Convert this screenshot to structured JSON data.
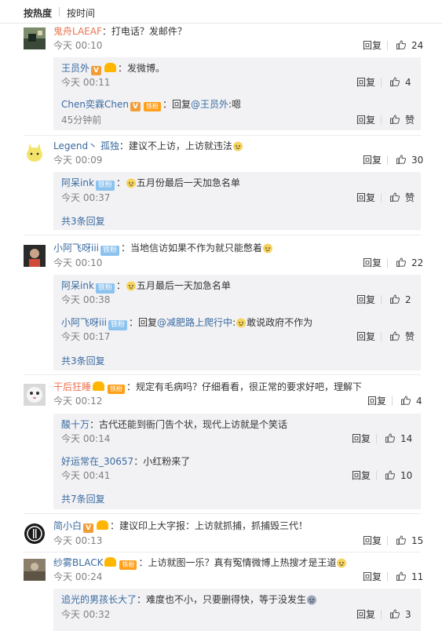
{
  "sort_tabs": {
    "hot": "按热度",
    "time": "按时间"
  },
  "labels": {
    "reply": "回复",
    "like": "赞"
  },
  "comments": [
    {
      "user": "鬼舟LAEAF",
      "text": "：打电话？发邮件？",
      "time": "今天 00:10",
      "likes": "24",
      "replies": [
        {
          "user": "王员外",
          "text": "：发微博。",
          "time": "今天 00:11",
          "likes": "4"
        },
        {
          "user": "Chen奕霖Chen",
          "badge_text": "铁粉",
          "text": "：回复",
          "mention": "@王员外",
          "text2": ":嗯",
          "time": "45分钟前",
          "likes": "赞"
        }
      ]
    },
    {
      "user": "Legend丶 孤独",
      "text": "：建议不上访，上访就违法",
      "time": "今天 00:09",
      "likes": "30",
      "replies": [
        {
          "user": "阿呆ink",
          "badge_text": "铁粉",
          "text": "：",
          "text2": "五月份最后一天加急名单",
          "time": "今天 00:37",
          "likes": "赞"
        }
      ],
      "more": "共3条回复"
    },
    {
      "user": "小阿飞呀iii",
      "badge_text": "铁粉",
      "text": "：当地信访如果不作为就只能憋着",
      "time": "今天 00:10",
      "likes": "22",
      "replies": [
        {
          "user": "阿呆ink",
          "badge_text": "铁粉",
          "text": "：",
          "text2": "五月最后一天加急名单",
          "time": "今天 00:38",
          "likes": "2"
        },
        {
          "user": "小阿飞呀iii",
          "badge_text": "铁粉",
          "text": "：回复",
          "mention": "@减肥路上爬行中",
          "text2": ":",
          "text3": "敢说政府不作为",
          "time": "今天 00:17",
          "likes": "赞"
        }
      ],
      "more": "共3条回复"
    },
    {
      "user": "干后狂睡",
      "badge_text": "铁粉",
      "text": "：规定有毛病吗？仔细看看，很正常的要求好吧，理解下",
      "time": "今天 00:12",
      "likes": "4",
      "replies": [
        {
          "user": "酸十万",
          "text": "：古代还能到衙门告个状，现代上访就是个笑话",
          "time": "今天 00:14",
          "likes": "14"
        },
        {
          "user": "好运常在_30657",
          "text": "：小红粉来了",
          "time": "今天 00:41",
          "likes": "10"
        }
      ],
      "more": "共7条回复"
    },
    {
      "user": "简小白",
      "text": "：建议印上大字报：上访就抓捕，抓捕毁三代！",
      "time": "今天 00:13",
      "likes": "15"
    },
    {
      "user": "纱雾BLACK",
      "badge_text": "铁粉",
      "text": "：上访就图一乐？真有冤情微博上热搜才是王道",
      "time": "今天 00:24",
      "likes": "11",
      "replies": [
        {
          "user": "追光的男孩长大了",
          "text": "：难度也不小，只要删得快，等于没发生",
          "time": "今天 00:32",
          "likes": "3"
        }
      ]
    }
  ]
}
